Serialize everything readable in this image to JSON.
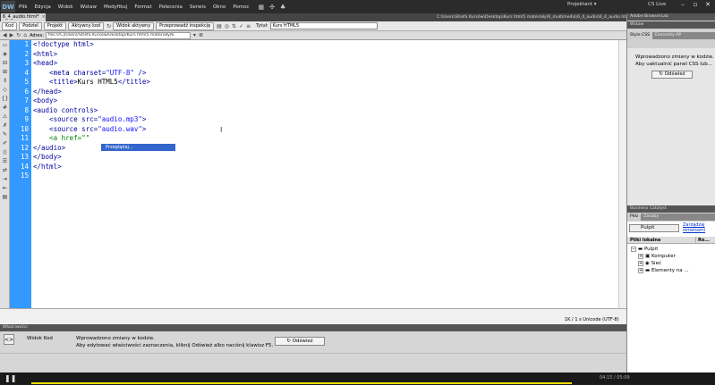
{
  "app": {
    "logo": "DW",
    "menu": [
      "Plik",
      "Edycja",
      "Widok",
      "Wstaw",
      "Modyfikuj",
      "Format",
      "Polecenia",
      "Serwis",
      "Okno",
      "Pomoc"
    ],
    "workspace": "Projektant ▾",
    "cslive": "CS Live",
    "file_path": "C:\\Users\\Strefa Kursów\\Desktop\\Kurs html5 materiały\\6_multimedia\\6_4_audio\\6_4_audio.html",
    "doc_tab": "6_4_audio.html*"
  },
  "toolbar": {
    "buttons": [
      "Kod",
      "Podziel",
      "Projekt",
      "Aktywny kod",
      "Widok aktywny",
      "Przeprowadź inspekcję"
    ],
    "title_label": "Tytuł:",
    "title_value": "Kurs HTML5"
  },
  "address": {
    "label": "Adres:",
    "value": "file:///C|/Users/Strefa Kursów/Desktop/Kurs html5 materiały/6"
  },
  "code": {
    "lines": [
      [
        {
          "t": "<!doctype html>",
          "c": "tag"
        }
      ],
      [
        {
          "t": "<html>",
          "c": "tag"
        }
      ],
      [
        {
          "t": "<head>",
          "c": "tag"
        }
      ],
      [
        {
          "t": "    <meta charset=",
          "c": "tag"
        },
        {
          "t": "\"UTF-8\"",
          "c": "str"
        },
        {
          "t": " />",
          "c": "tag"
        }
      ],
      [
        {
          "t": "    <title>",
          "c": "tag"
        },
        {
          "t": "Kurs HTML5",
          "c": "txt"
        },
        {
          "t": "</title>",
          "c": "tag"
        }
      ],
      [
        {
          "t": "</head>",
          "c": "tag"
        }
      ],
      [
        {
          "t": "<body>",
          "c": "tag"
        }
      ],
      [
        {
          "t": "<audio controls>",
          "c": "tag"
        }
      ],
      [
        {
          "t": "    <source src=",
          "c": "tag"
        },
        {
          "t": "\"audio.mp3\"",
          "c": "str"
        },
        {
          "t": ">",
          "c": "tag"
        }
      ],
      [
        {
          "t": "    <source src=",
          "c": "tag"
        },
        {
          "t": "\"audio.wav\"",
          "c": "str"
        },
        {
          "t": ">",
          "c": "tag"
        }
      ],
      [
        {
          "t": "    <a href=",
          "c": "anchor"
        },
        {
          "t": "\"\"",
          "c": "anchor"
        }
      ],
      [
        {
          "t": "</audio>",
          "c": "tag"
        }
      ],
      [
        {
          "t": "</body>",
          "c": "tag"
        }
      ],
      [
        {
          "t": "</html>",
          "c": "tag"
        }
      ],
      []
    ],
    "autocomplete": "Przeglądaj..."
  },
  "status": {
    "text": "1K / 1 s  Unicode (UTF-8)"
  },
  "properties": {
    "title": "Właściwości",
    "view_label": "Widok Kod",
    "message_line1": "Wprowadzono zmiany w kodzie.",
    "message_line2": "Aby edytować właściwości zaznaczenia, kliknij Odśwież albo naciśnij klawisz F5.",
    "refresh": "Odśwież"
  },
  "right_panel": {
    "browserlab": "Adobe BrowserLab",
    "insert": "Wstaw",
    "css_tabs": [
      "Style CSS",
      "Elementy AP"
    ],
    "css_msg1": "Wprowadzono zmiany w kodzie.",
    "css_msg2": "Aby uaktualnić panel CSS lub...",
    "css_refresh": "Odśwież",
    "business_catalyst": "Business Catalyst",
    "files_tabs": [
      "Pliki",
      "Zasoby"
    ],
    "site": "Pulpit",
    "manage_sites": "Zarządzaj serwisami",
    "local_files": "Pliki lokalne",
    "size_col": "Ro...",
    "tree": [
      "Pulpit",
      "Komputer",
      "Sieć",
      "Elementy na ..."
    ]
  },
  "video": {
    "time": "04:15 / 05:09"
  }
}
